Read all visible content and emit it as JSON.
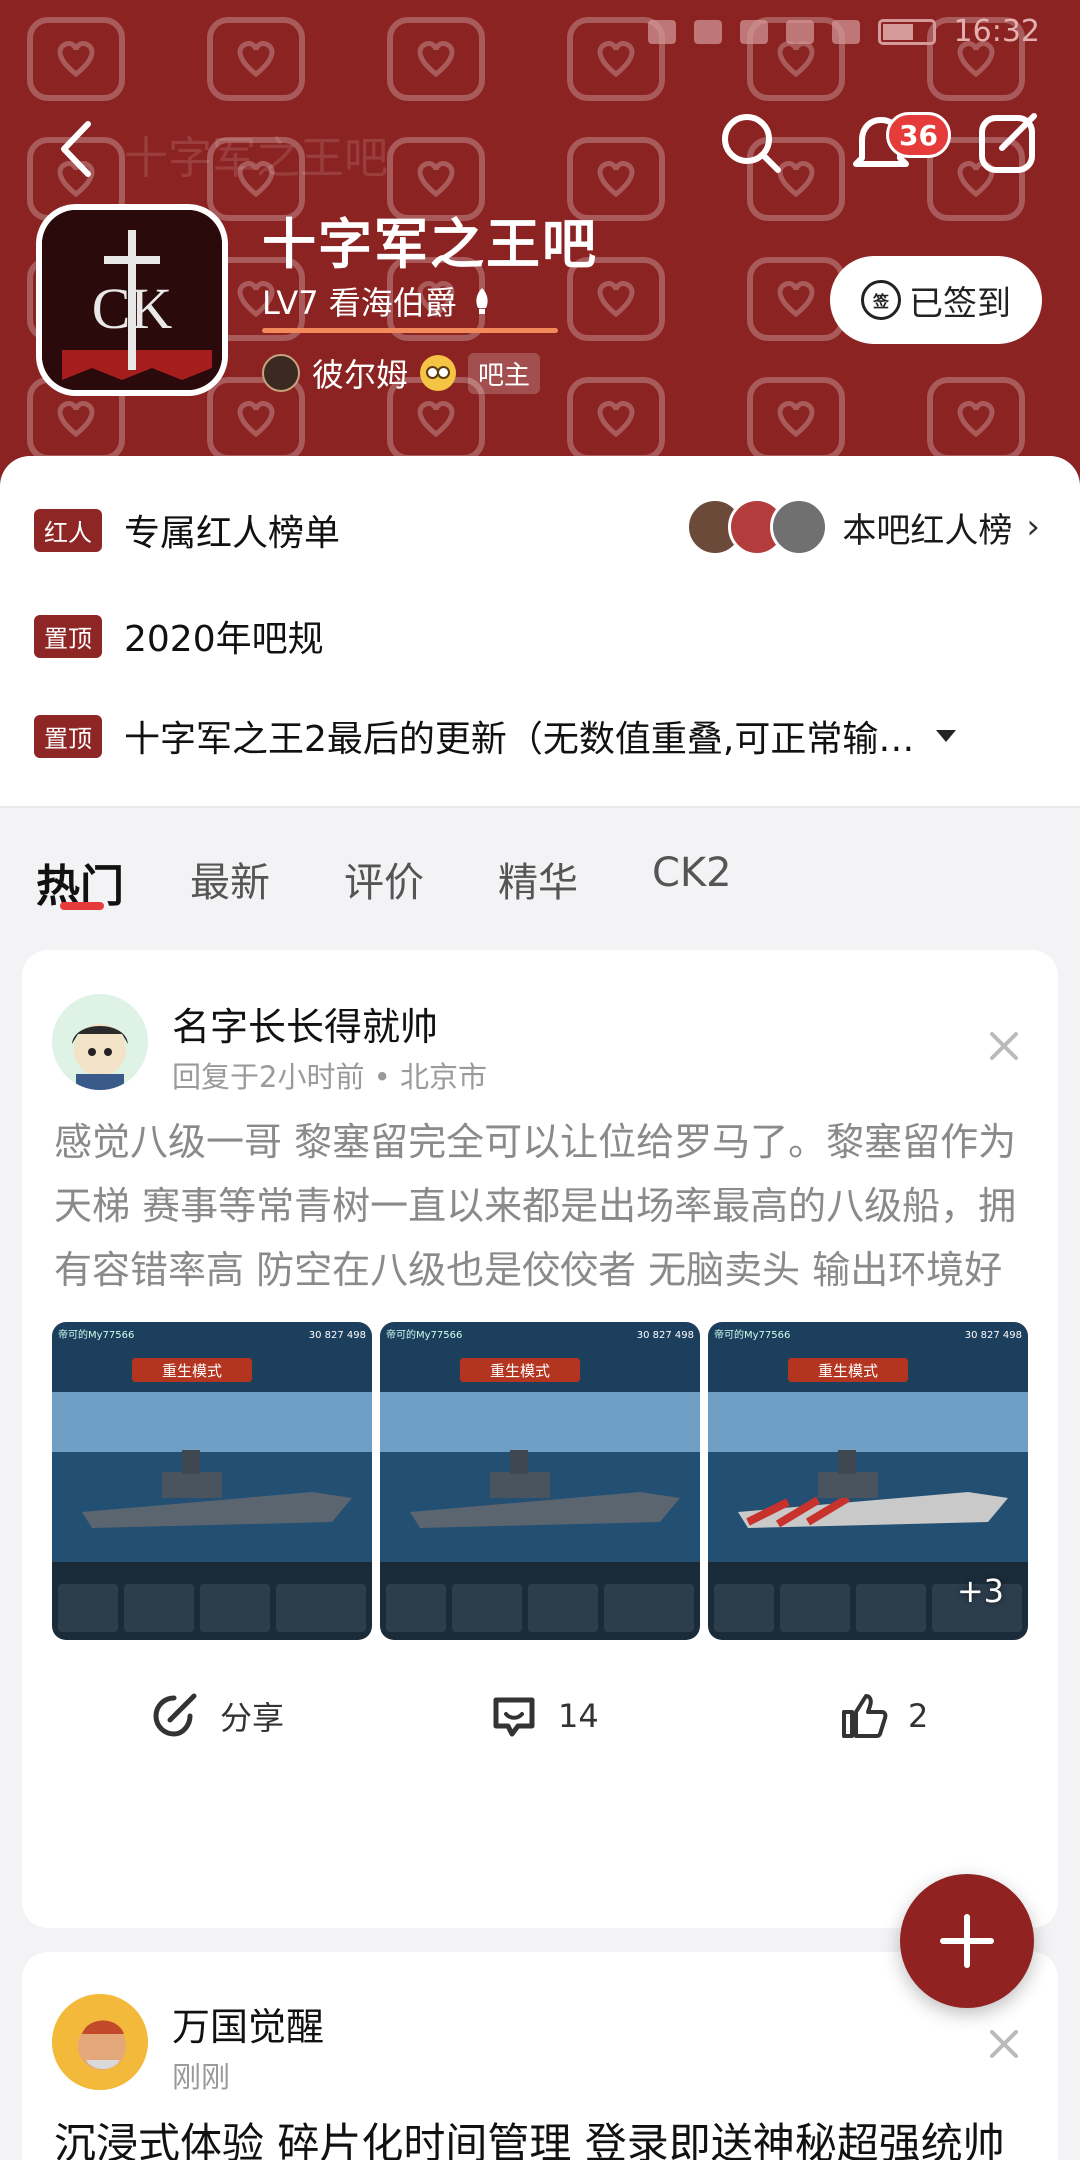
{
  "status_bar": {
    "time": "16:32"
  },
  "nav": {
    "faded_title": "十字军之王吧",
    "notification_count": "36"
  },
  "forum": {
    "logo_text": "CK",
    "name": "十字军之王吧",
    "level": "LV7 看海伯爵",
    "level_progress_percent": 100,
    "moderator_name": "彼尔姆",
    "moderator_tag": "吧主",
    "checkin_icon_text": "签",
    "checkin_label": "已签到"
  },
  "pinned": [
    {
      "tag": "红人",
      "text": "专属红人榜单"
    },
    {
      "tag": "置顶",
      "text": "2020年吧规"
    },
    {
      "tag": "置顶",
      "text": "十字军之王2最后的更新（无数值重叠,可正常输…"
    }
  ],
  "celeb_link": "本吧红人榜",
  "tabs": [
    "热门",
    "最新",
    "评价",
    "精华",
    "CK2"
  ],
  "posts": [
    {
      "author": "名字长长得就帅",
      "meta": "回复于2小时前 • 北京市",
      "text": "感觉八级一哥 黎塞留完全可以让位给罗马了。黎塞留作为天梯 赛事等常青树一直以来都是出场率最高的八级船，拥有容错率高 防空在八级也是佼佼者 无脑卖头 输出环境好的等优点。对于现在的游戏来讲这点优势已经相当不明显",
      "images": [
        {
          "label": "重生模式",
          "player": "帝可的My77566",
          "coins": "30 827 498"
        },
        {
          "label": "重生模式",
          "player": "帝可的My77566",
          "coins": "30 827 498"
        },
        {
          "label": "重生模式",
          "player": "帝可的My77566",
          "coins": "30 827 498"
        }
      ],
      "more_images": "+3",
      "share_label": "分享",
      "comments": "14",
      "likes": "2"
    },
    {
      "author": "万国觉醒",
      "meta": "刚刚",
      "text": "沉浸式体验 碎片化时间管理 登录即送神秘超强统帅"
    }
  ],
  "colors": {
    "header": "#8c2323",
    "accent_red": "#e53b3b",
    "tag_red": "#8f2626"
  }
}
